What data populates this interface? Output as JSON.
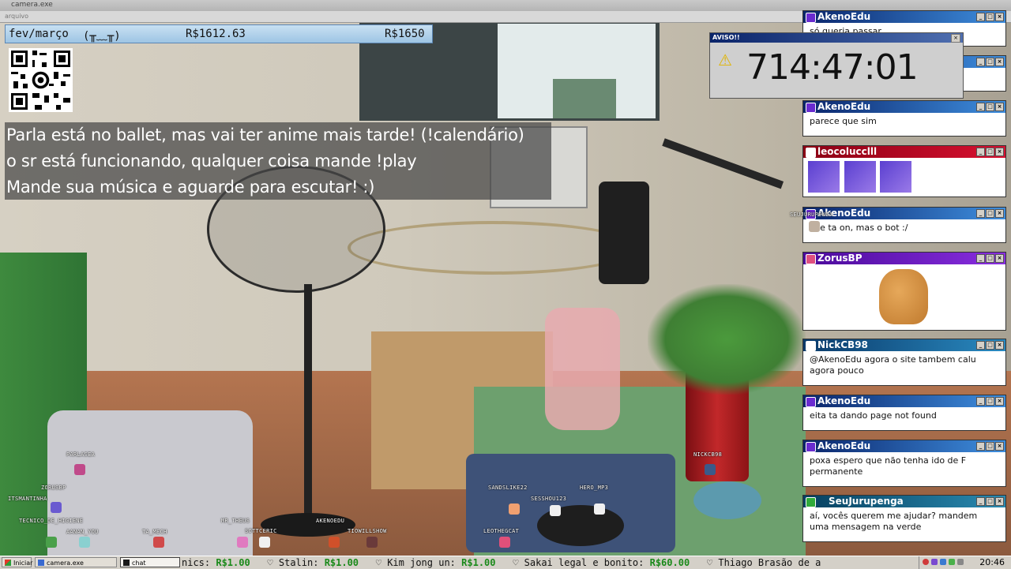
{
  "window": {
    "title": "camera.exe",
    "menu": "arquivo"
  },
  "goal_bar": {
    "month": "fev/março",
    "face": "(╥﹏╥)",
    "current": "R$1612.63",
    "goal": "R$1650",
    "progress_fraction": 0.977
  },
  "overlay_lines": [
    "Parla está no ballet, mas vai ter anime mais tarde! (!calendário)",
    "o sr está funcionando, qualquer coisa mande !play",
    "Mande sua música e aguarde para escutar! :)"
  ],
  "timer_window": {
    "title": "AVISO!!",
    "time": "714:47:01",
    "icon": "warning-icon"
  },
  "chat": [
    {
      "user": "AkenoEdu",
      "color": "#0a246a",
      "message": "só queria passar..."
    },
    {
      "user": "",
      "color": "#0a246a",
      "message": ""
    },
    {
      "user": "AkenoEdu",
      "color": "#0a246a",
      "message": "parece que sim"
    },
    {
      "user": "leocolucclll",
      "color": "#8a0014",
      "message": ""
    },
    {
      "user": "AkenoEdu",
      "color": "#0a246a",
      "message": "site ta on, mas o bot :/"
    },
    {
      "user": "ZorusBP",
      "color": "#4a0a9a",
      "message": ""
    },
    {
      "user": "NickCB98",
      "color": "#0a3a6a",
      "message": "@AkenoEdu agora o site tambem calu agora pouco"
    },
    {
      "user": "AkenoEdu",
      "color": "#0a246a",
      "message": "eita ta dando page not found"
    },
    {
      "user": "AkenoEdu",
      "color": "#0a246a",
      "message": "poxa espero que não tenha ido de F permanente"
    },
    {
      "user": "SeuJurupenga",
      "color": "#064060",
      "message": "aí, vocês querem me ajudar? mandem uma mensagem na verde"
    }
  ],
  "name_tags": [
    "PARLASEA",
    "ZORUSBP",
    "ITSMANTINHA",
    "TECNICO_DE_HIGIENE",
    "AANAN_YOU",
    "TA_MECH",
    "MR_THEUS",
    "SOTTCERIC",
    "AKENOEDU",
    "TIOWILLSHOW",
    "SANDSLIKE22",
    "SESSHOU123",
    "HERO_MP3",
    "LEOTHEGCAT",
    "NICKCB98",
    "SEUJURUPENGA"
  ],
  "taskbar": {
    "start_label": "Iniciar",
    "windows": [
      "camera.exe",
      "chat"
    ],
    "ticker": [
      {
        "name": "nics:",
        "value": "R$1.00"
      },
      {
        "name": "Stalin:",
        "value": "R$1.00"
      },
      {
        "name": "Kim jong un:",
        "value": "R$1.00"
      },
      {
        "name": "Sakai legal e bonito:",
        "value": "R$60.00"
      },
      {
        "name": "Thiago Brasão de a",
        "value": ""
      }
    ],
    "clock": "20:46"
  }
}
